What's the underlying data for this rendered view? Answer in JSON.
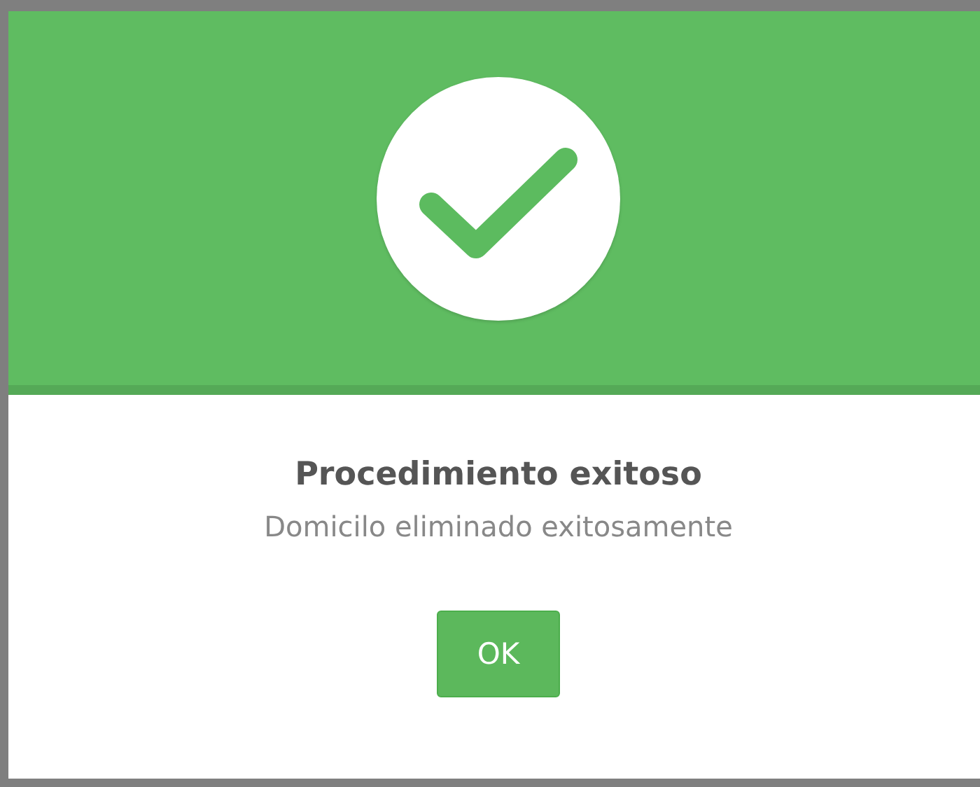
{
  "dialog": {
    "title": "Procedimiento exitoso",
    "message": "Domicilo eliminado exitosamente",
    "buttons": [
      {
        "label": "OK"
      }
    ]
  }
}
